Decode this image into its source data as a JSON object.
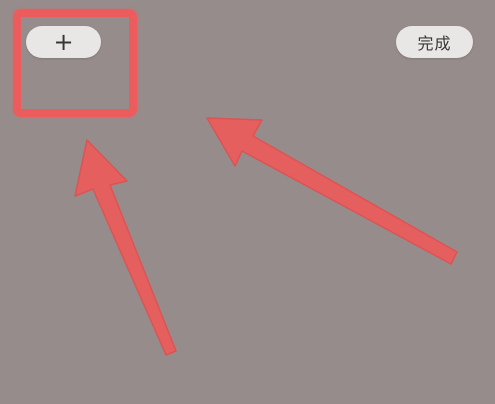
{
  "toolbar": {
    "add_icon": "plus-icon",
    "add_label": "+",
    "done_label": "完成"
  },
  "annotation": {
    "color": "#ec5c5c"
  },
  "background_color": "#978c8c"
}
